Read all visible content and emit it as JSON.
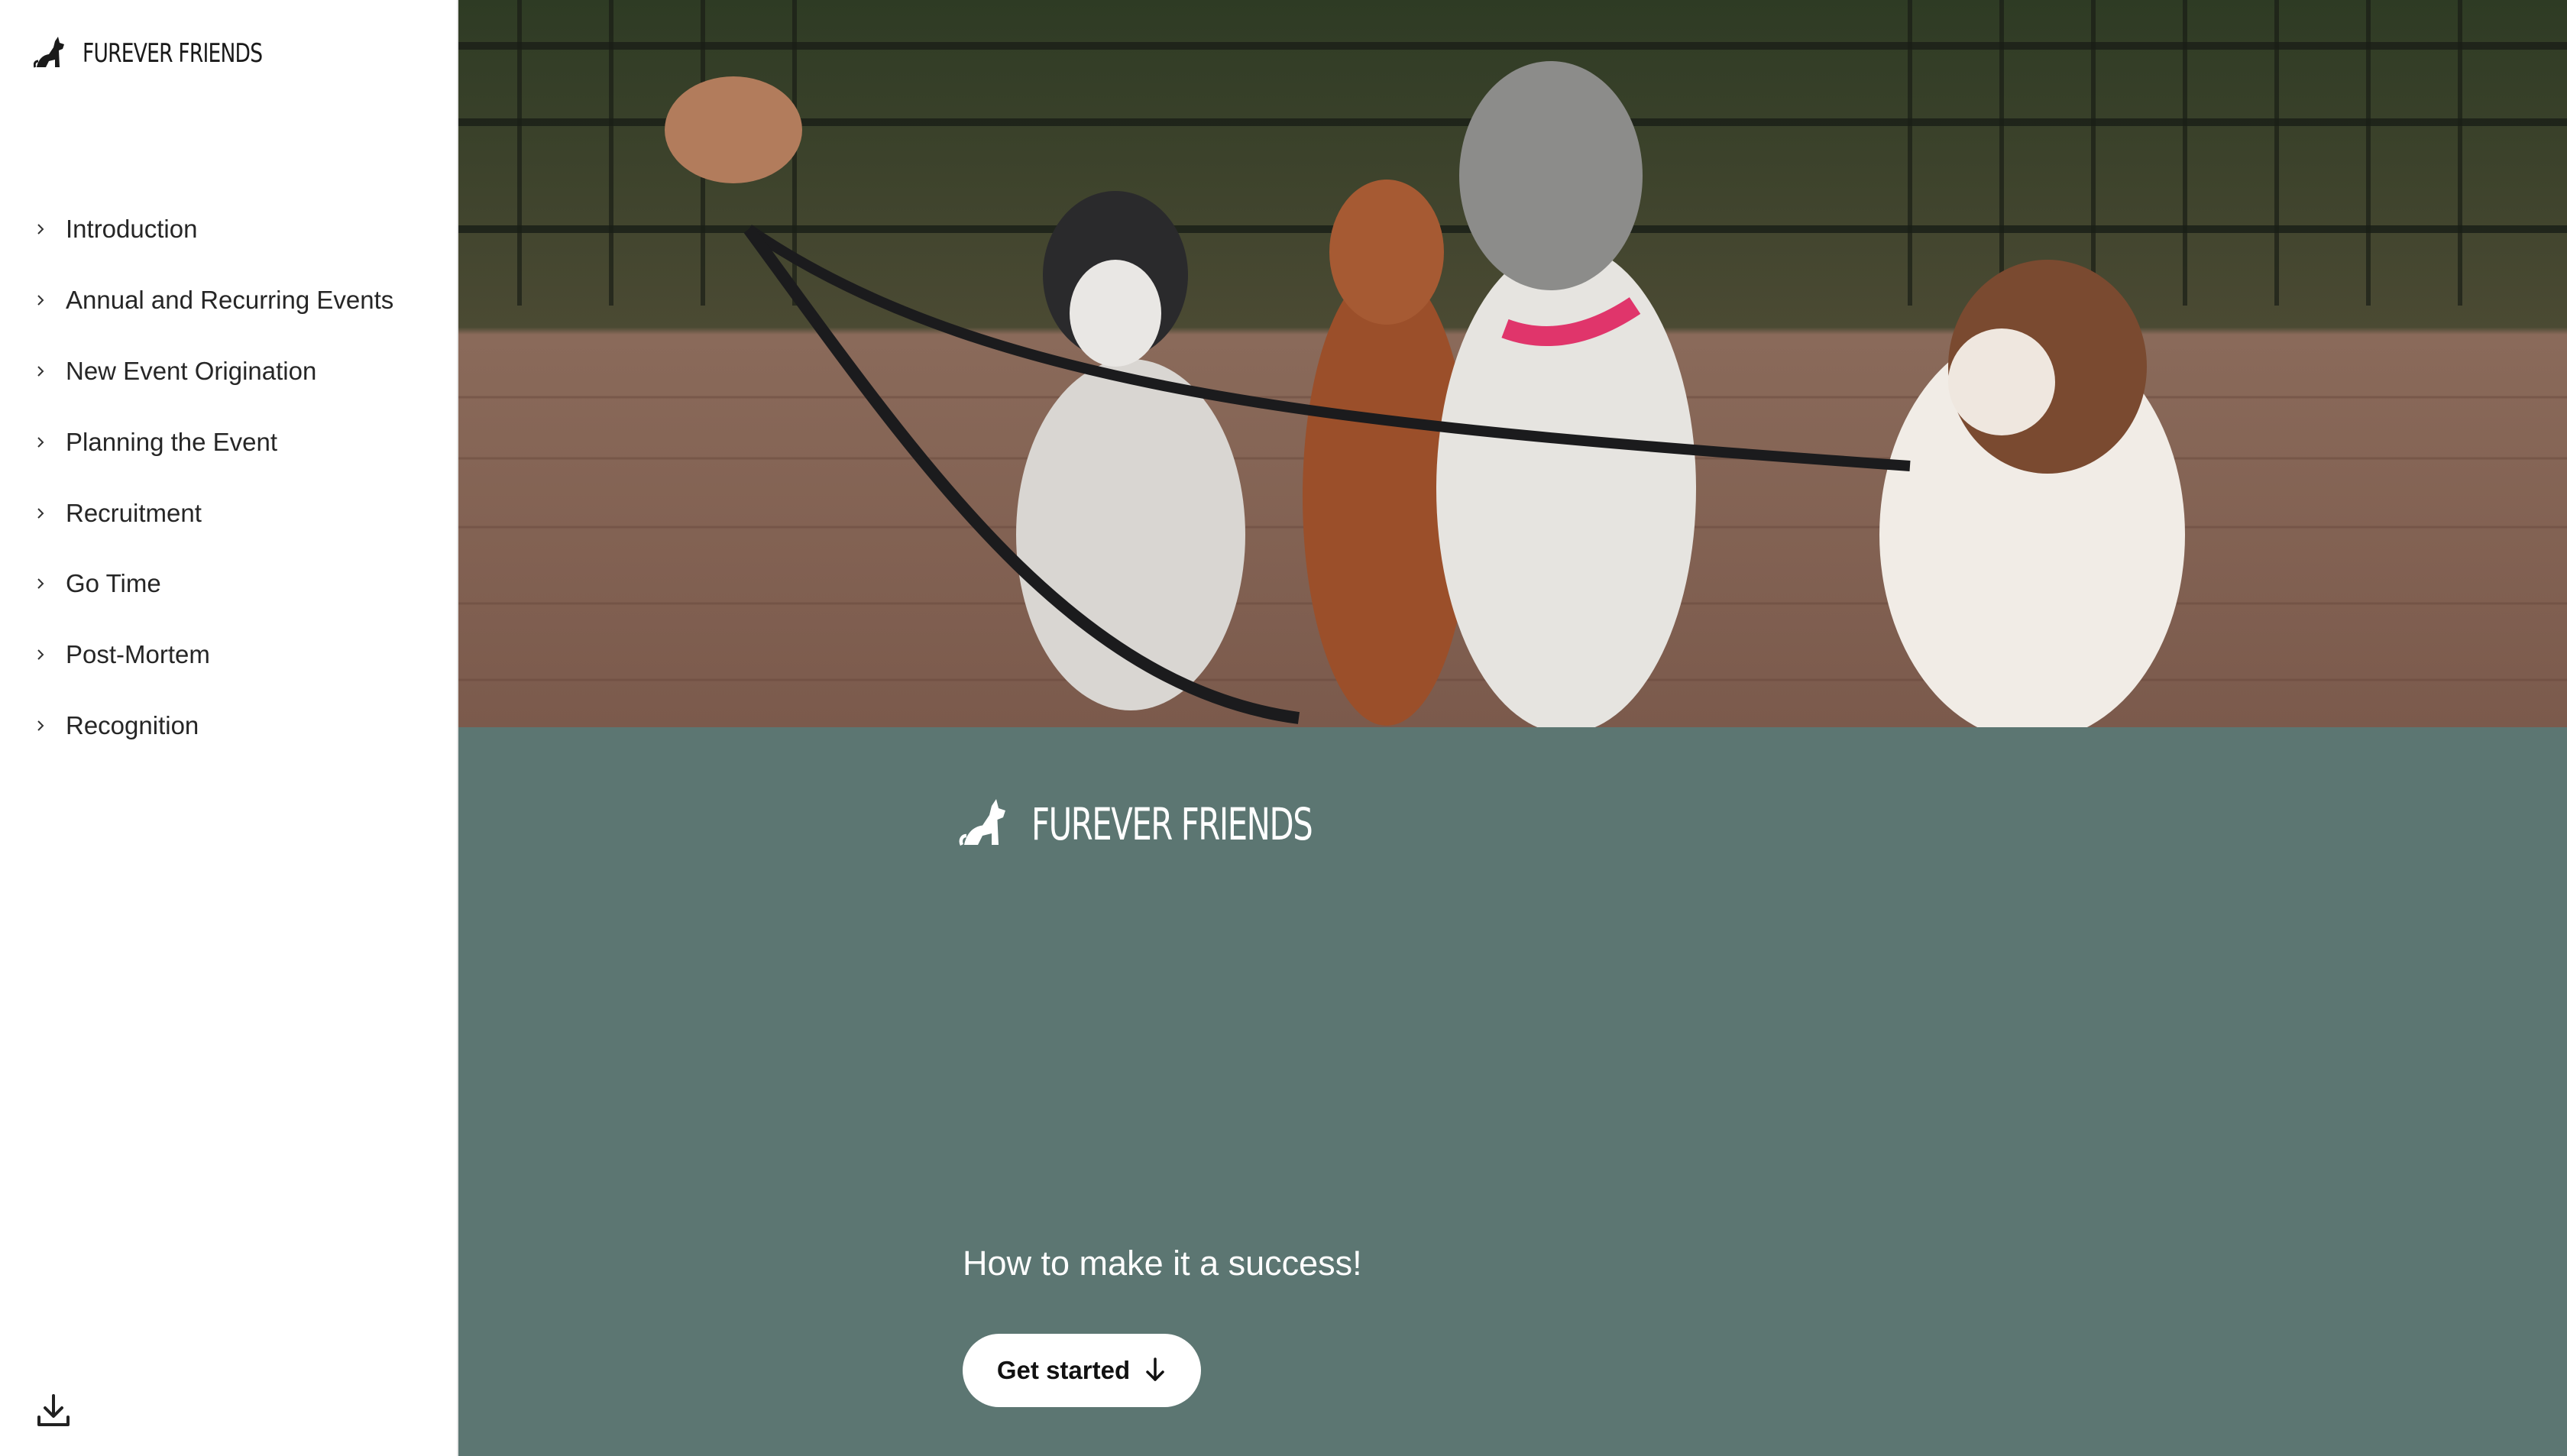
{
  "brand": {
    "name": "FUREVER FRIENDS"
  },
  "sidebar": {
    "items": [
      {
        "label": "Introduction"
      },
      {
        "label": "Annual and Recurring Events"
      },
      {
        "label": "New Event Origination"
      },
      {
        "label": "Planning the Event"
      },
      {
        "label": "Recruitment"
      },
      {
        "label": "Go Time"
      },
      {
        "label": "Post-Mortem"
      },
      {
        "label": "Recognition"
      }
    ],
    "download_icon": "download-icon"
  },
  "hero": {
    "image": "photo-of-four-dogs-on-leashes",
    "cover": {
      "tagline": "How to make it a success!",
      "cta_label": "Get started",
      "cta_icon": "arrow-down-icon"
    }
  },
  "colors": {
    "cover_background": "#5c7672",
    "sidebar_background": "#ffffff",
    "cta_background": "#ffffff"
  }
}
